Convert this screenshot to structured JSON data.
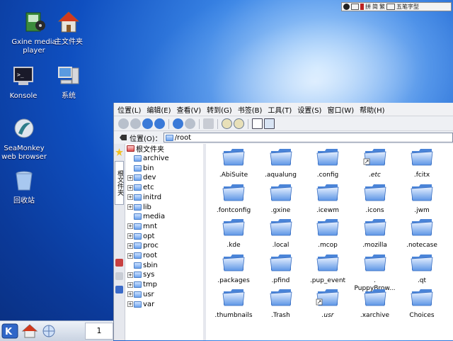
{
  "desktop": {
    "icons": [
      {
        "label": "Gxine media player",
        "icon": "media-player-icon"
      },
      {
        "label": "主文件夹",
        "icon": "home-folder-icon"
      },
      {
        "label": "Konsole",
        "icon": "terminal-icon"
      },
      {
        "label": "系统",
        "icon": "computer-icon"
      },
      {
        "label": "SeaMonkey web browser",
        "icon": "browser-icon"
      },
      {
        "label": "回收站",
        "icon": "trash-icon"
      }
    ]
  },
  "systray": {
    "items": [
      "拼",
      "简",
      "繁",
      "五笔字型"
    ]
  },
  "taskbar": {
    "pager": "1"
  },
  "filemanager": {
    "menus": [
      "位置(L)",
      "编辑(E)",
      "查看(V)",
      "转到(G)",
      "书签(B)",
      "工具(T)",
      "设置(S)",
      "窗口(W)",
      "帮助(H)"
    ],
    "location_label": "位置(O)：",
    "location_value": "/root",
    "side_tab_label": "根文件夹",
    "tree_root": "根文件夹",
    "tree_items": [
      {
        "name": "archive",
        "expandable": false
      },
      {
        "name": "bin",
        "expandable": false
      },
      {
        "name": "dev",
        "expandable": true
      },
      {
        "name": "etc",
        "expandable": true
      },
      {
        "name": "initrd",
        "expandable": true
      },
      {
        "name": "lib",
        "expandable": true
      },
      {
        "name": "media",
        "expandable": false
      },
      {
        "name": "mnt",
        "expandable": true
      },
      {
        "name": "opt",
        "expandable": true
      },
      {
        "name": "proc",
        "expandable": true
      },
      {
        "name": "root",
        "expandable": true
      },
      {
        "name": "sbin",
        "expandable": false
      },
      {
        "name": "sys",
        "expandable": true
      },
      {
        "name": "tmp",
        "expandable": true
      },
      {
        "name": "usr",
        "expandable": true
      },
      {
        "name": "var",
        "expandable": true
      }
    ],
    "files": [
      {
        "name": ".AbiSuite",
        "link": false
      },
      {
        "name": ".aqualung",
        "link": false
      },
      {
        "name": ".config",
        "link": false
      },
      {
        "name": ".etc",
        "link": true
      },
      {
        "name": ".fcitx",
        "link": false
      },
      {
        "name": ".fontconfig",
        "link": false
      },
      {
        "name": ".gxine",
        "link": false
      },
      {
        "name": ".icewm",
        "link": false
      },
      {
        "name": ".icons",
        "link": false
      },
      {
        "name": ".jwm",
        "link": false
      },
      {
        "name": ".kde",
        "link": false
      },
      {
        "name": ".local",
        "link": false
      },
      {
        "name": ".mcop",
        "link": false
      },
      {
        "name": ".mozilla",
        "link": false
      },
      {
        "name": ".notecase",
        "link": false
      },
      {
        "name": ".packages",
        "link": false
      },
      {
        "name": ".pfind",
        "link": false
      },
      {
        "name": ".pup_event",
        "link": false
      },
      {
        "name": ".\nPuppyBrow...",
        "link": false
      },
      {
        "name": ".qt",
        "link": false
      },
      {
        "name": ".thumbnails",
        "link": false
      },
      {
        "name": ".Trash",
        "link": false
      },
      {
        "name": ".usr",
        "link": true
      },
      {
        "name": ".xarchive",
        "link": false
      },
      {
        "name": "Choices",
        "link": false
      }
    ]
  },
  "colors": {
    "accent": "#0b3a9a",
    "folder": "#6ea4ee"
  }
}
